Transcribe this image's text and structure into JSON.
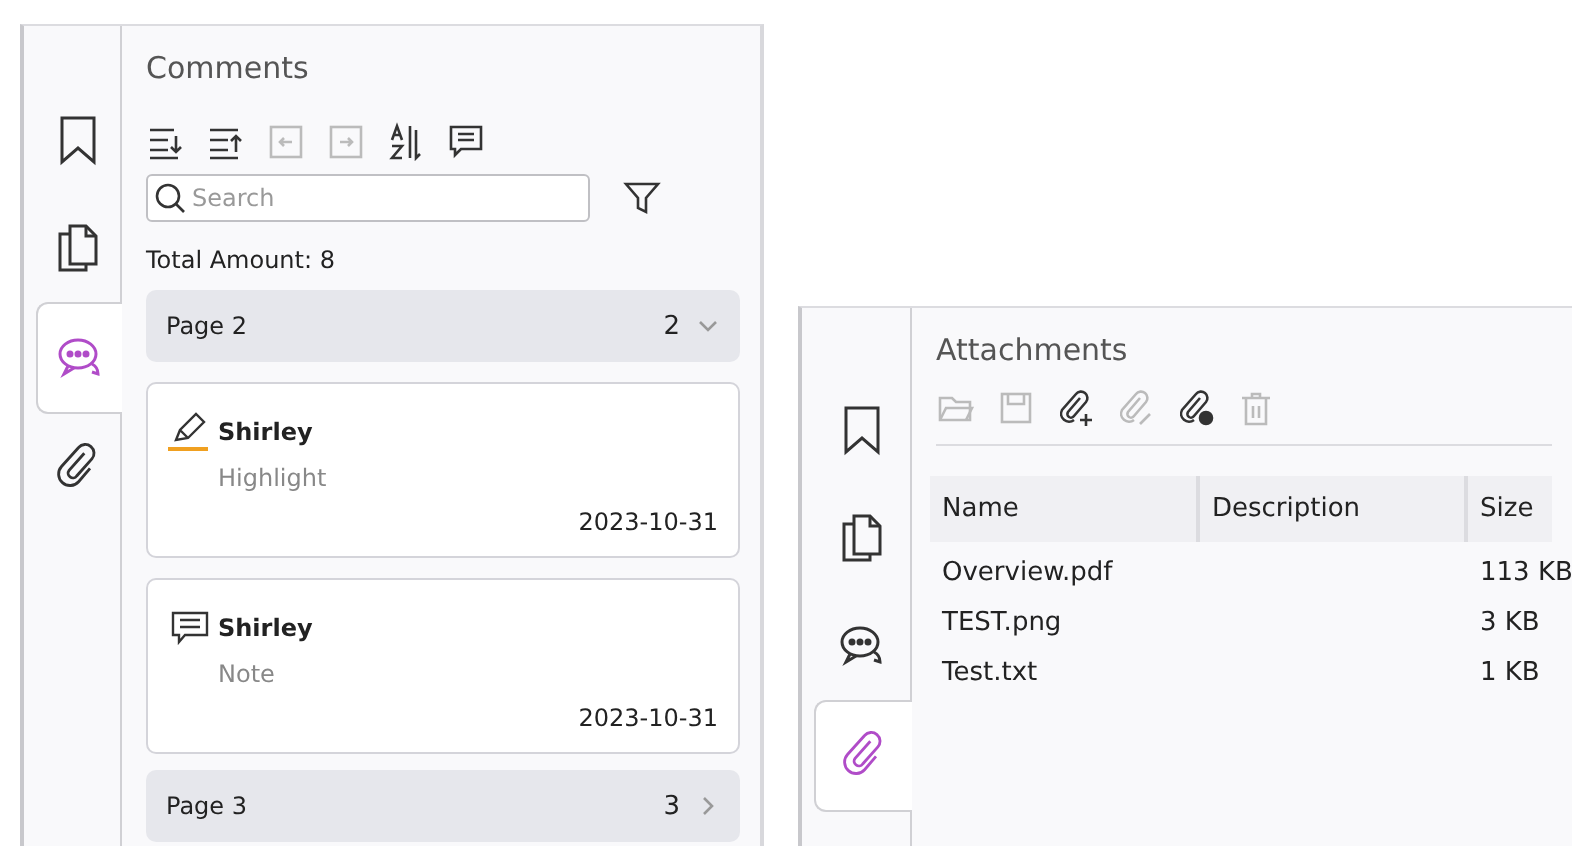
{
  "panels": [
    {
      "kind": "comments",
      "title": "Comments",
      "tabs": [
        {
          "kind": "bookmark",
          "selected": false
        },
        {
          "kind": "pages",
          "selected": false
        },
        {
          "kind": "comments",
          "selected": true
        },
        {
          "kind": "attachments",
          "selected": false
        }
      ],
      "toolbar": [
        {
          "kind": "expand",
          "disabled": false
        },
        {
          "kind": "collapse",
          "disabled": false
        },
        {
          "kind": "prev",
          "disabled": true
        },
        {
          "kind": "next",
          "disabled": true
        },
        {
          "kind": "sort",
          "disabled": false
        },
        {
          "kind": "note",
          "disabled": false
        }
      ],
      "search": {
        "placeholder": "Search"
      },
      "total": "Total Amount: 8",
      "groups": [
        {
          "label": "Page 2",
          "count": "2",
          "expanded": true,
          "comments": [
            {
              "kind": "highlight",
              "author": "Shirley",
              "type": "Highlight",
              "date": "2023-10-31"
            },
            {
              "kind": "note",
              "author": "Shirley",
              "type": "Note",
              "date": "2023-10-31"
            }
          ]
        },
        {
          "label": "Page 3",
          "count": "3",
          "expanded": false
        }
      ]
    },
    {
      "kind": "attachments",
      "title": "Attachments",
      "tabs": [
        {
          "kind": "bookmark",
          "selected": false
        },
        {
          "kind": "pages",
          "selected": false
        },
        {
          "kind": "comments",
          "selected": false
        },
        {
          "kind": "attachments",
          "selected": true
        }
      ],
      "toolbar": [
        {
          "kind": "open",
          "disabled": true
        },
        {
          "kind": "save",
          "disabled": true
        },
        {
          "kind": "add",
          "disabled": false
        },
        {
          "kind": "edit",
          "disabled": true
        },
        {
          "kind": "properties",
          "disabled": false
        },
        {
          "kind": "delete",
          "disabled": true
        }
      ],
      "columns": [
        "Name",
        "Description",
        "Size"
      ],
      "rows": [
        [
          "Overview.pdf",
          "",
          "113 KB"
        ],
        [
          "TEST.png",
          "",
          "3 KB"
        ],
        [
          "Test.txt",
          "",
          "1 KB"
        ]
      ]
    }
  ]
}
